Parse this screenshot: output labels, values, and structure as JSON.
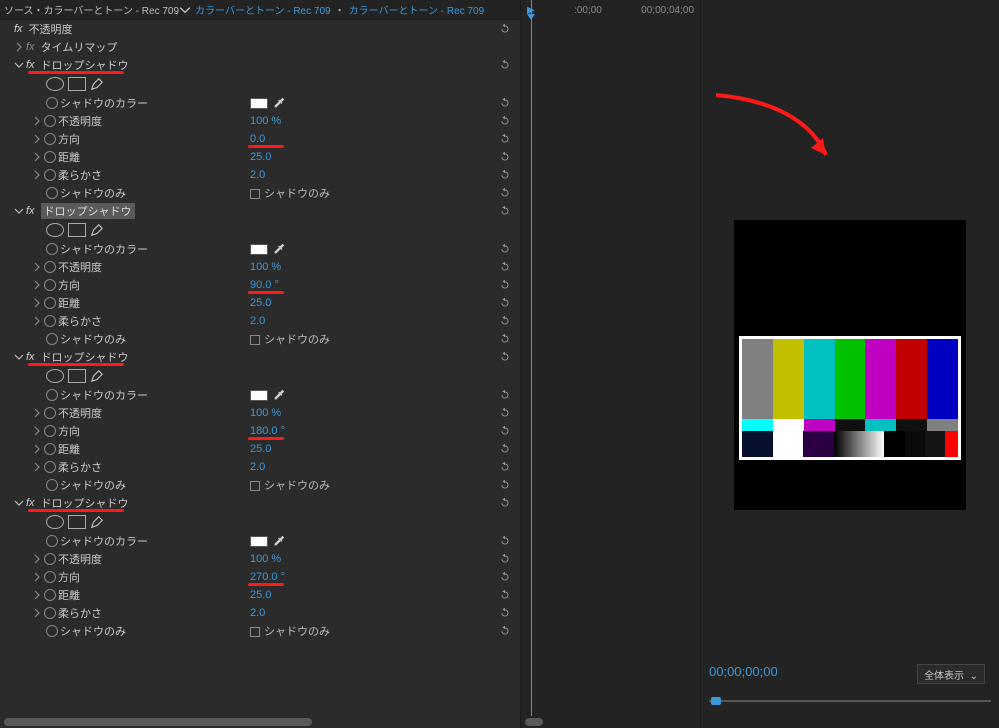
{
  "crumb": {
    "source_prefix": "ソース・",
    "source_name": "カラーバーとトーン - Rec 709",
    "link1": "カラーバーとトーン - Rec 709",
    "sep": "・",
    "link2": "カラーバーとトーン - Rec 709"
  },
  "static_effects": {
    "opacity": "不透明度",
    "timeremap": "タイムリマップ"
  },
  "shadow_label": "ドロップシャドウ",
  "prop": {
    "color": "シャドウのカラー",
    "opacity": "不透明度",
    "direction": "方向",
    "distance": "距離",
    "softness": "柔らかさ",
    "only": "シャドウのみ",
    "only_cb": "シャドウのみ"
  },
  "shadows": [
    {
      "opacity": "100 %",
      "direction": "0.0",
      "distance": "25.0",
      "softness": "2.0",
      "selected": false,
      "dir_suffix": ""
    },
    {
      "opacity": "100 %",
      "direction": "90.0 ",
      "distance": "25.0",
      "softness": "2.0",
      "selected": true,
      "dir_suffix": "°"
    },
    {
      "opacity": "100 %",
      "direction": "180.0 ",
      "distance": "25.0",
      "softness": "2.0",
      "selected": false,
      "dir_suffix": "°"
    },
    {
      "opacity": "100 %",
      "direction": "270.0 ",
      "distance": "25.0",
      "softness": "2.0",
      "selected": false,
      "dir_suffix": "°"
    }
  ],
  "timeline": {
    "start": ":00;00",
    "mid": "00;00;04;00"
  },
  "preview": {
    "tc": "00;00;00;00",
    "zoom": "全体表示"
  },
  "bars": {
    "top": [
      "#808080",
      "#c0c000",
      "#00c0c0",
      "#00c000",
      "#c000c0",
      "#c00000",
      "#0000c0"
    ],
    "mid": [
      "#0000c0",
      "#101010",
      "#c000c0",
      "#101010",
      "#00c0c0",
      "#101010",
      "#808080"
    ],
    "bot_left": [
      "#081030",
      "#ffffff",
      "#2a0042"
    ],
    "grad": [
      "#000",
      "#fff"
    ],
    "bot_right": [
      "#000",
      "#0a0a0a",
      "#141414"
    ]
  }
}
